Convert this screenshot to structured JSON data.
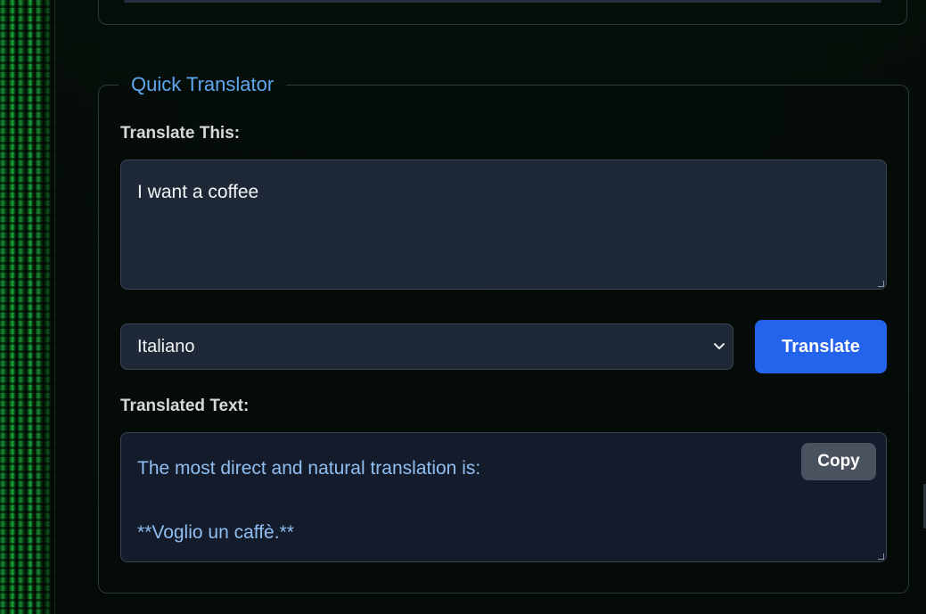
{
  "translator": {
    "title": "Quick Translator",
    "source_label": "Translate This:",
    "source_text": "I want a coffee",
    "target_language": "Italiano",
    "translate_button": "Translate",
    "output_label": "Translated Text:",
    "output_lines": [
      "The most direct and natural translation is:",
      "",
      "**Voglio un caffè.**"
    ],
    "copy_button": "Copy"
  },
  "colors": {
    "accent": "#2463eb",
    "title": "#5fa8f0",
    "output_text": "#8fbff2",
    "field_bg": "#1f2836"
  },
  "icons": {
    "select_chevron": "chevron-down-icon"
  }
}
